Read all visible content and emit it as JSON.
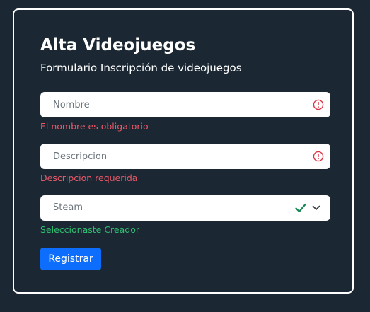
{
  "form": {
    "title": "Alta Videojuegos",
    "subtitle": "Formulario Inscripción de videojuegos",
    "fields": {
      "nombre": {
        "placeholder": "Nombre",
        "value": "",
        "status": "invalid",
        "feedback": "El nombre es obligatorio",
        "status_icon": "alert-circle-icon"
      },
      "descripcion": {
        "placeholder": "Descripcion",
        "value": "",
        "status": "invalid",
        "feedback": "Descripcion requerida",
        "status_icon": "alert-circle-icon"
      },
      "creador": {
        "selected": "Steam",
        "status": "valid",
        "feedback": "Seleccionaste Creador",
        "status_icon": "check-icon",
        "dropdown_icon": "chevron-down-icon"
      }
    },
    "submit_label": "Registrar"
  },
  "colors": {
    "background": "#1b2833",
    "card_border": "#ffffff",
    "invalid": "#ea5868",
    "valid": "#2fbf71",
    "primary_button": "#0d6efd"
  }
}
